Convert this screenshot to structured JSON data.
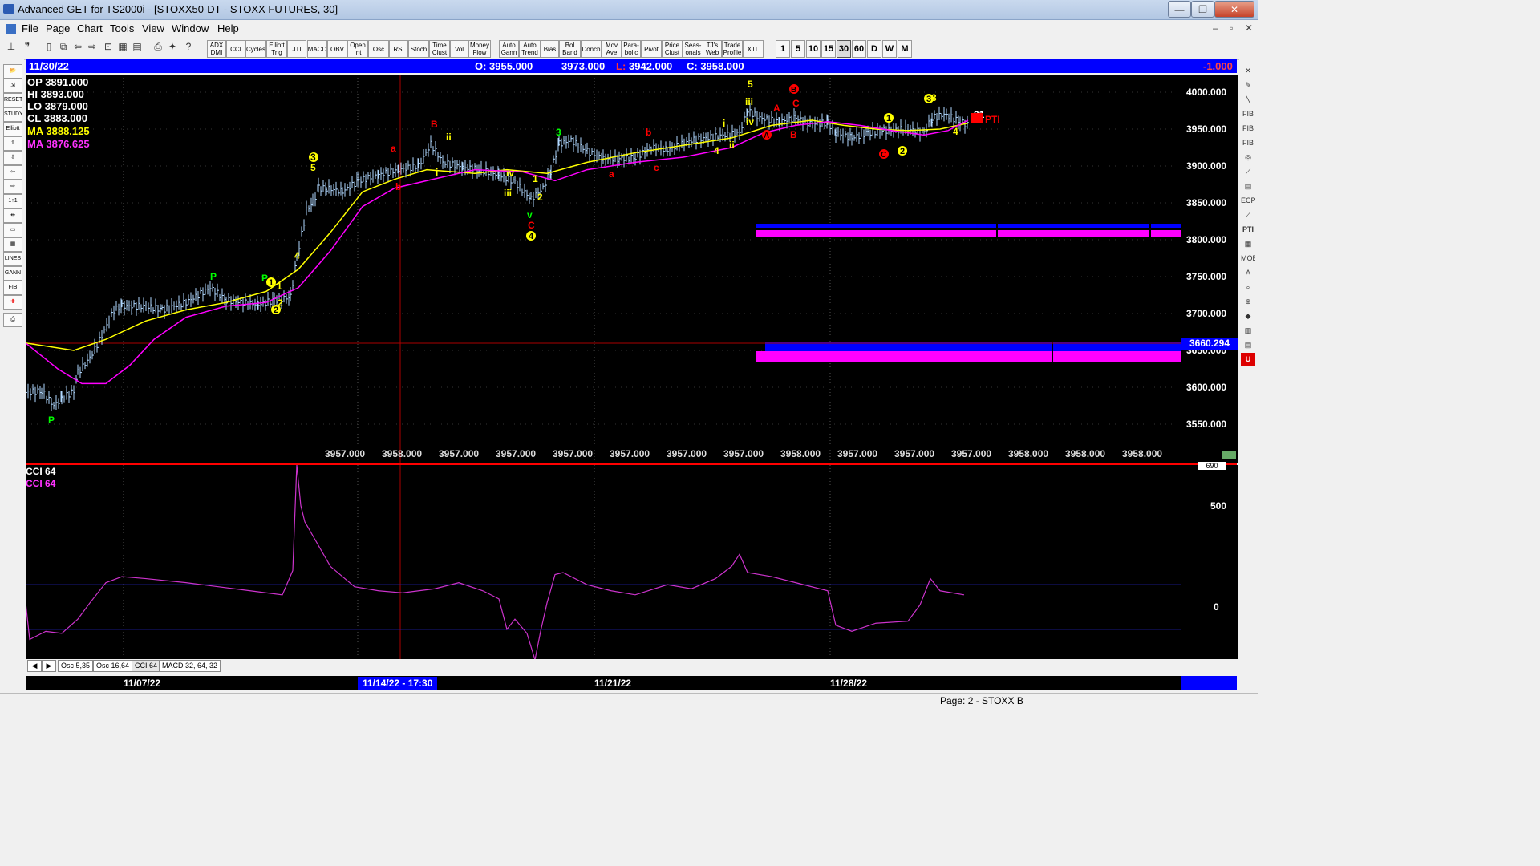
{
  "window": {
    "title": "Advanced GET for TS2000i - [STOXX50-DT - STOXX FUTURES, 30]",
    "controls": [
      "—",
      "❐",
      "✕"
    ],
    "mdi_controls": [
      "–",
      "▫",
      "✕"
    ]
  },
  "menu": [
    "File",
    "Page",
    "Chart",
    "Tools",
    "View",
    "Window",
    "Help"
  ],
  "toolbar": {
    "study_buttons": [
      "ADX DMI",
      "CCI",
      "Cycles",
      "Elliott Trig",
      "JTI",
      "MACD",
      "OBV",
      "Open Int",
      "Osc",
      "RSI",
      "Stoch",
      "Time Clust",
      "Vol",
      "Money Flow",
      "Auto Gann",
      "Auto Trend",
      "Bias",
      "Bol Band",
      "Donch",
      "Mov Ave",
      "Para-bolic",
      "Pivot",
      "Price Clust",
      "Seas-onals",
      "TJ's Web",
      "Trade Profile",
      "XTL"
    ],
    "intervals": [
      "1",
      "5",
      "10",
      "15",
      "30",
      "60",
      "D",
      "W",
      "M"
    ]
  },
  "info_bar": {
    "date": "11/30/22",
    "open": "O: 3955.000",
    "high": "3973.000",
    "low_label": "L:",
    "low": "3942.000",
    "close": "C: 3958.000",
    "change": "-1.000"
  },
  "price_legend": [
    {
      "label": "OP",
      "value": "3891.000",
      "color": "#ffffff"
    },
    {
      "label": "HI",
      "value": "3893.000",
      "color": "#ffffff"
    },
    {
      "label": "LO",
      "value": "3879.000",
      "color": "#ffffff"
    },
    {
      "label": "CL",
      "value": "3883.000",
      "color": "#ffffff"
    },
    {
      "label": "MA",
      "value": "3888.125",
      "color": "#ffff00"
    },
    {
      "label": "MA",
      "value": "3876.625",
      "color": "#ff33ff"
    }
  ],
  "price_axis": {
    "ticks": [
      "4000.000",
      "3950.000",
      "3900.000",
      "3850.000",
      "3800.000",
      "3750.000",
      "3700.000",
      "3650.000",
      "3600.000",
      "3550.000"
    ],
    "current_price_tag": "3660.294"
  },
  "bottom_values": [
    "3957.000",
    "3958.000",
    "3957.000",
    "3957.000",
    "3957.000",
    "3957.000",
    "3957.000",
    "3957.000",
    "3958.000",
    "3957.000",
    "3957.000",
    "3957.000",
    "3958.000",
    "3958.000",
    "3958.000"
  ],
  "elliott_labels": [
    {
      "t": "P",
      "c": "#00ff00"
    },
    {
      "t": "P",
      "c": "#00ff00"
    },
    {
      "t": "P",
      "c": "#00ff00"
    },
    {
      "t": "1",
      "c": "#ffff00"
    },
    {
      "t": "2",
      "c": "#ffff00"
    },
    {
      "t": "3",
      "c": "#ffff00"
    },
    {
      "t": "4",
      "c": "#ffff00"
    },
    {
      "t": "5",
      "c": "#ffff00"
    },
    {
      "t": "a",
      "c": "#ff0000"
    },
    {
      "t": "b",
      "c": "#ff0000"
    },
    {
      "t": "B",
      "c": "#ff0000"
    },
    {
      "t": "ii",
      "c": "#ffff00"
    },
    {
      "t": "i",
      "c": "#ffff00"
    },
    {
      "t": "iv",
      "c": "#ffff00"
    },
    {
      "t": "iii",
      "c": "#ffff00"
    },
    {
      "t": "v",
      "c": "#00ff00"
    },
    {
      "t": "C",
      "c": "#ff0000"
    },
    {
      "t": "1",
      "c": "#ffff00"
    },
    {
      "t": "2",
      "c": "#ffff00"
    },
    {
      "t": "3",
      "c": "#00ff00"
    },
    {
      "t": "a",
      "c": "#ff0000"
    },
    {
      "t": "b",
      "c": "#ff0000"
    },
    {
      "t": "c",
      "c": "#ff0000"
    },
    {
      "t": "4",
      "c": "#ffff00"
    },
    {
      "t": "ii",
      "c": "#ffff00"
    },
    {
      "t": "i",
      "c": "#ffff00"
    },
    {
      "t": "iii",
      "c": "#ffff00"
    },
    {
      "t": "iv",
      "c": "#ffff00"
    },
    {
      "t": "5",
      "c": "#ffff00"
    },
    {
      "t": "A",
      "c": "#ff0000"
    },
    {
      "t": "C",
      "c": "#ff0000"
    },
    {
      "t": "B",
      "c": "#ff0000"
    },
    {
      "t": "4",
      "c": "#ffff00"
    },
    {
      "t": "3",
      "c": "#ffff00"
    },
    {
      "t": "PTI",
      "c": "#ff0000"
    },
    {
      "t": "31",
      "c": "#ffffff"
    }
  ],
  "cci_pane": {
    "legend": [
      {
        "text": "CCI 64",
        "color": "#ffffff"
      },
      {
        "text": "CCI  64",
        "color": "#ff33ff"
      }
    ],
    "ticks": [
      "500",
      "0"
    ],
    "top_tick": "690"
  },
  "tabs": [
    "Osc 5,35",
    "Osc 16,64",
    "CCI 64",
    "MACD 32, 64, 32"
  ],
  "date_axis": [
    "11/07/22",
    "11/14/22 - 17:30",
    "11/21/22",
    "11/28/22"
  ],
  "status": "Page: 2 - STOXX B",
  "colors": {
    "ma_fast": "#ffff00",
    "ma_slow": "#ff00ff",
    "bars": "#b0d8ff",
    "cci": "#cc33cc",
    "zone_blue": "#0000ff",
    "zone_magenta": "#ff00ff"
  }
}
